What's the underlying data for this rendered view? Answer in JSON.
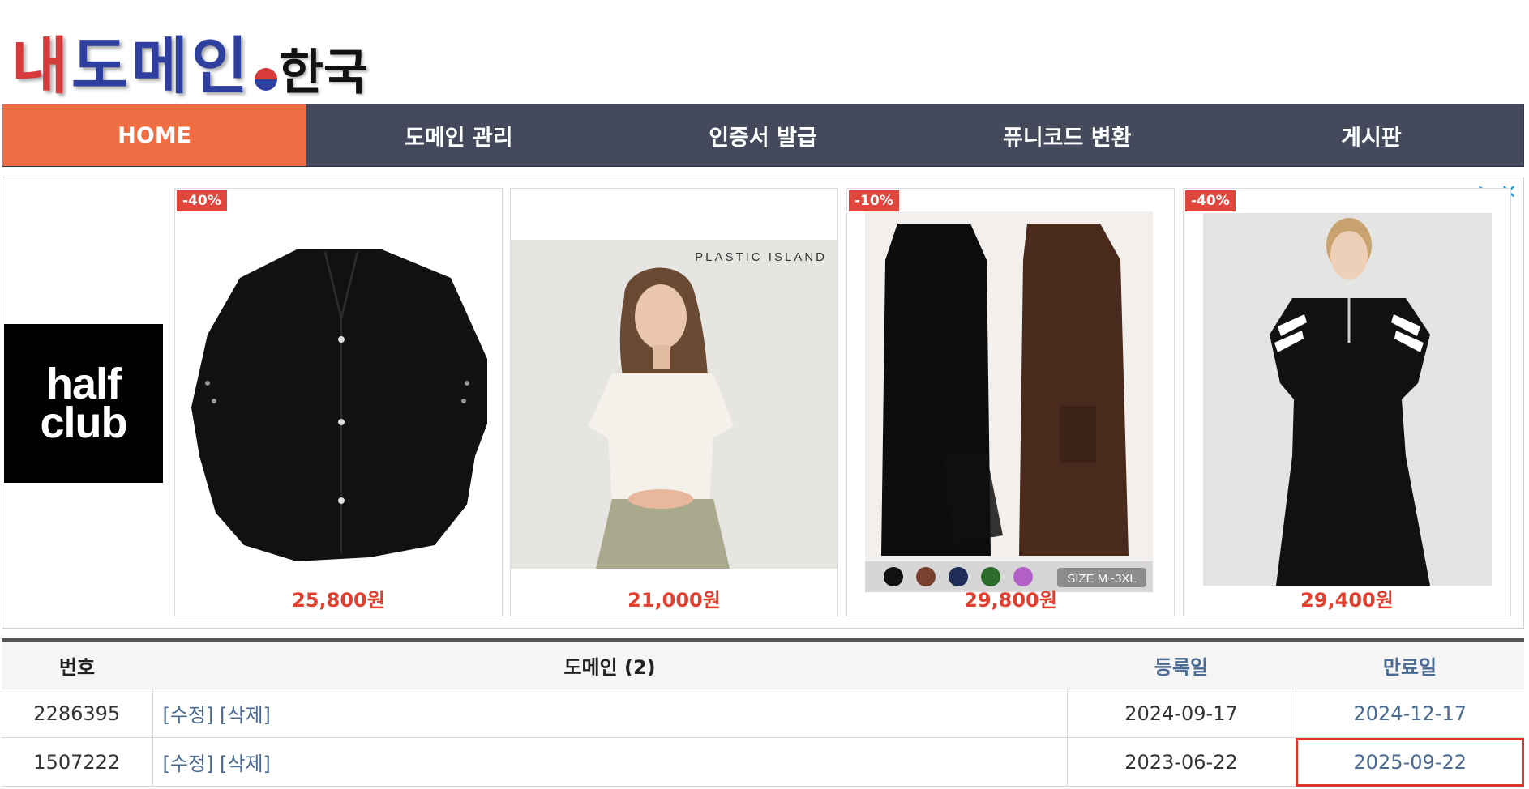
{
  "logo": {
    "word_red": "내",
    "word_blue": "도메",
    "word_red2": "인",
    "word_tail": "한국"
  },
  "nav": {
    "items": [
      {
        "label": "HOME"
      },
      {
        "label": "도메인 관리"
      },
      {
        "label": "인증서 발급"
      },
      {
        "label": "퓨니코드 변환"
      },
      {
        "label": "게시판"
      }
    ]
  },
  "ad": {
    "brand": "half club",
    "brand_line1": "half",
    "brand_line2": "club",
    "info_icon": "adchoices-icon",
    "close_icon": "close-icon",
    "products": [
      {
        "badge": "-40%",
        "price": "25,800원"
      },
      {
        "badge": "",
        "price": "21,000원",
        "photo_text": "PLASTIC ISLAND"
      },
      {
        "badge": "-10%",
        "price": "29,800원",
        "photo_text": "SIZE M~3XL"
      },
      {
        "badge": "-40%",
        "price": "29,400원"
      }
    ]
  },
  "table": {
    "headers": {
      "no": "번호",
      "domain": "도메인 (2)",
      "registered": "등록일",
      "expires": "만료일"
    },
    "rows": [
      {
        "no": "2286395",
        "edit": "[수정]",
        "delete": "[삭제]",
        "registered": "2024-09-17",
        "expires": "2024-12-17"
      },
      {
        "no": "1507222",
        "edit": "[수정]",
        "delete": "[삭제]",
        "registered": "2023-06-22",
        "expires": "2025-09-22"
      }
    ]
  }
}
